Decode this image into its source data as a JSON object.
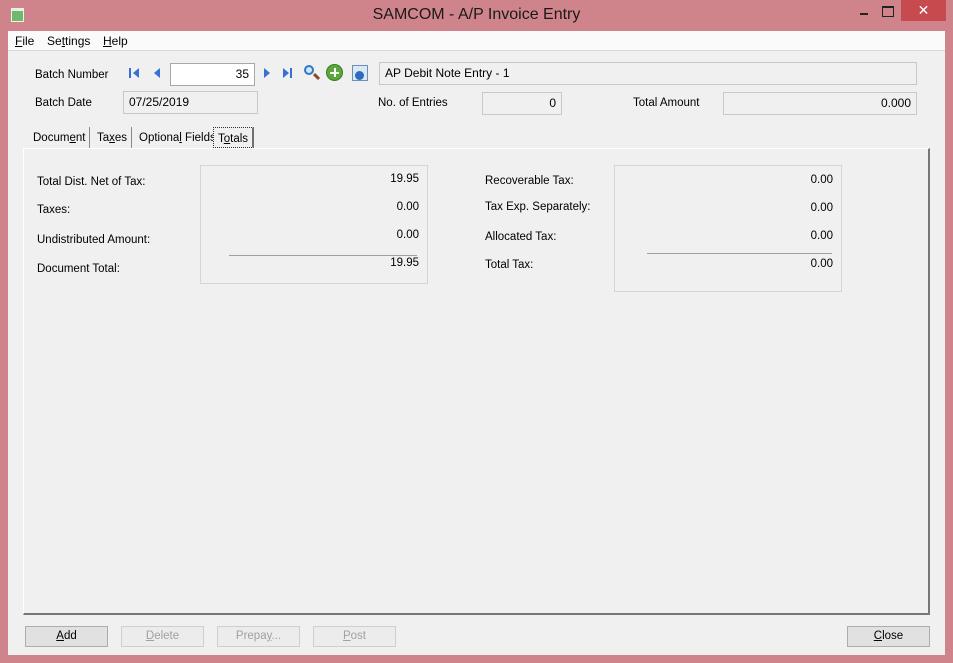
{
  "window": {
    "title": "SAMCOM - A/P Invoice Entry",
    "close_glyph": "✕"
  },
  "menu": {
    "file": {
      "pre": "",
      "key": "F",
      "post": "ile"
    },
    "settings": {
      "pre": "Se",
      "key": "t",
      "post": "tings"
    },
    "help": {
      "pre": "",
      "key": "H",
      "post": "elp"
    }
  },
  "header": {
    "batch_number_label": "Batch Number",
    "batch_number_value": "35",
    "batch_description": "AP Debit Note Entry - 1",
    "batch_date_label": "Batch Date",
    "batch_date_value": "07/25/2019",
    "entries_label": "No. of Entries",
    "entries_value": "0",
    "total_amount_label": "Total Amount",
    "total_amount_value": "0.000"
  },
  "tabs": [
    {
      "pre": "Docum",
      "key": "e",
      "post": "nt"
    },
    {
      "pre": "Ta",
      "key": "x",
      "post": "es"
    },
    {
      "pre": "Optiona",
      "key": "l",
      "post": " Fields"
    },
    {
      "pre": "T",
      "key": "o",
      "post": "tals"
    }
  ],
  "totals": {
    "left": [
      {
        "label": "Total Dist. Net of Tax:",
        "value": "19.95"
      },
      {
        "label": "Taxes:",
        "value": "0.00"
      },
      {
        "label": "Undistributed Amount:",
        "value": "0.00"
      },
      {
        "label": "Document Total:",
        "value": "19.95"
      }
    ],
    "right": [
      {
        "label": "Recoverable Tax:",
        "value": "0.00"
      },
      {
        "label": "Tax Exp. Separately:",
        "value": "0.00"
      },
      {
        "label": "Allocated Tax:",
        "value": "0.00"
      },
      {
        "label": "Total Tax:",
        "value": "0.00"
      }
    ]
  },
  "buttons": {
    "add": {
      "pre": "",
      "key": "A",
      "post": "dd"
    },
    "delete": {
      "pre": "",
      "key": "D",
      "post": "elete"
    },
    "prepay": {
      "pre": "Prepa",
      "key": "y",
      "post": "..."
    },
    "post": {
      "pre": "",
      "key": "P",
      "post": "ost"
    },
    "close": {
      "pre": "",
      "key": "C",
      "post": "lose"
    }
  }
}
